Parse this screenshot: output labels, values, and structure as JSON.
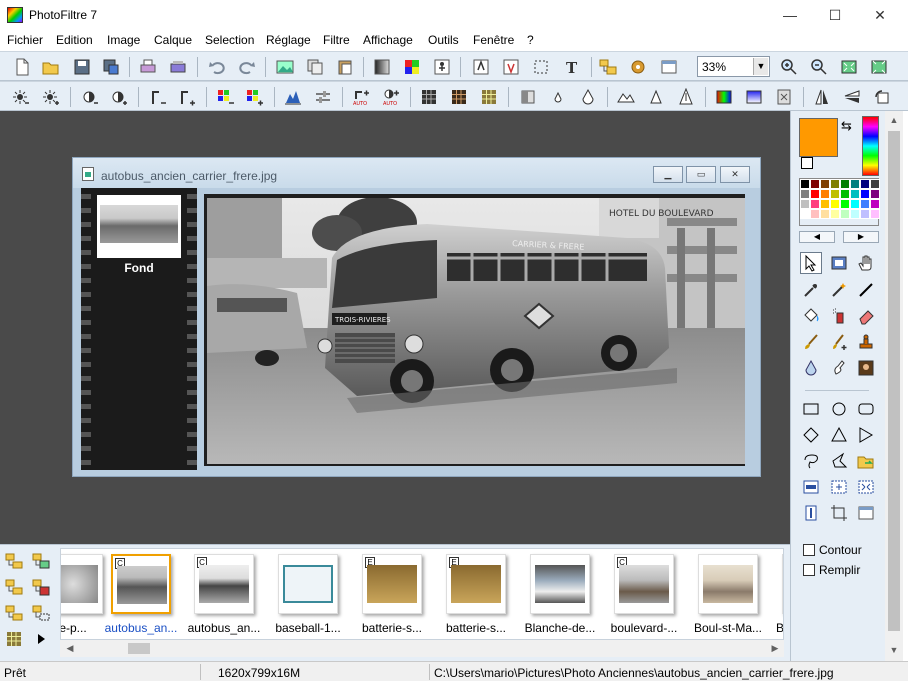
{
  "app": {
    "title": "PhotoFiltre 7"
  },
  "window_controls": {
    "minimize": "—",
    "maximize": "☐",
    "close": "✕"
  },
  "menu": [
    "Fichier",
    "Edition",
    "Image",
    "Calque",
    "Selection",
    "Réglage",
    "Filtre",
    "Affichage",
    "Outils",
    "Fenêtre",
    "?"
  ],
  "toolbar": {
    "zoom_value": "33%"
  },
  "document": {
    "name": "autobus_ancien_carrier_frere.jpg",
    "layer_name": "Fond",
    "photo_text": {
      "bus_side": "CARRIER & FRERE",
      "bus_front": "TROIS-RIVIERES",
      "sign": "HOTEL DU BOULEVARD"
    }
  },
  "colors": {
    "foreground": "#ff9900",
    "workspace": "#4a4a4a",
    "panel": "#e6eef6"
  },
  "panel": {
    "outline_label": "Contour",
    "fill_label": "Remplir"
  },
  "browser": {
    "thumbnails": [
      {
        "label": "e-p...",
        "badge": ""
      },
      {
        "label": "autobus_an...",
        "badge": "C"
      },
      {
        "label": "autobus_an...",
        "badge": "C"
      },
      {
        "label": "baseball-1...",
        "badge": ""
      },
      {
        "label": "batterie-s...",
        "badge": "E"
      },
      {
        "label": "batterie-s...",
        "badge": "E"
      },
      {
        "label": "Blanche-de...",
        "badge": ""
      },
      {
        "label": "boulevard-...",
        "badge": "C"
      },
      {
        "label": "Boul-st-Ma...",
        "badge": ""
      },
      {
        "label": "B",
        "badge": ""
      }
    ]
  },
  "status": {
    "state": "Prêt",
    "image_info": "1620x799x16M",
    "path": "C:\\Users\\mario\\Pictures\\Photo Anciennes\\autobus_ancien_carrier_frere.jpg"
  }
}
